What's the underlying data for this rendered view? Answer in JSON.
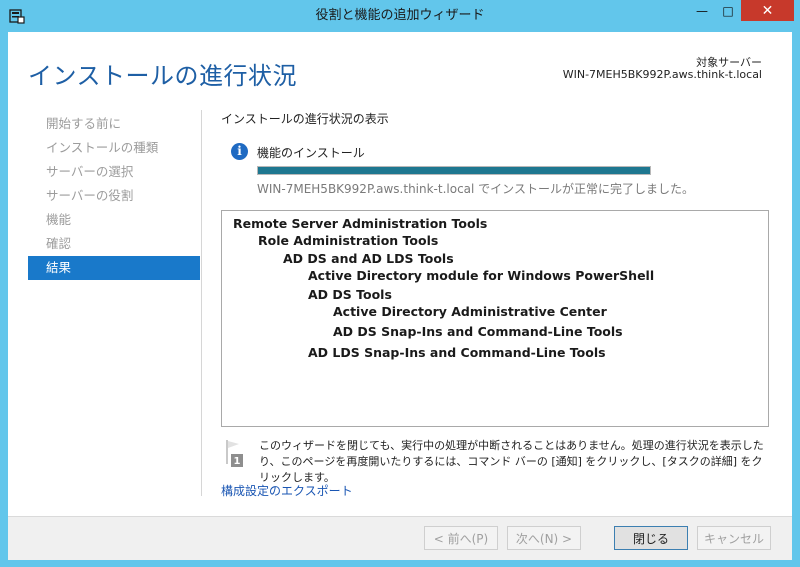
{
  "window": {
    "title": "役割と機能の追加ウィザード",
    "controls": {
      "minimize": "—",
      "maximize": "□",
      "close": "✕"
    }
  },
  "header": {
    "title": "インストールの進行状況",
    "destination_label": "対象サーバー",
    "destination_server": "WIN-7MEH5BK992P.aws.think-t.local"
  },
  "nav": {
    "items": [
      {
        "label": "開始する前に",
        "active": false
      },
      {
        "label": "インストールの種類",
        "active": false
      },
      {
        "label": "サーバーの選択",
        "active": false
      },
      {
        "label": "サーバーの役割",
        "active": false
      },
      {
        "label": "機能",
        "active": false
      },
      {
        "label": "確認",
        "active": false
      },
      {
        "label": "結果",
        "active": true
      }
    ]
  },
  "content": {
    "section_heading": "インストールの進行状況の表示",
    "info_icon_glyph": "i",
    "feature_label": "機能のインストール",
    "progress_fraction": 1.0,
    "status_text": "WIN-7MEH5BK992P.aws.think-t.local でインストールが正常に完了しました。",
    "tree": [
      {
        "text": "Remote Server Administration Tools",
        "level": 0
      },
      {
        "text": "Role Administration Tools",
        "level": 1
      },
      {
        "text": "AD DS and AD LDS Tools",
        "level": 2
      },
      {
        "text": "Active Directory module for Windows PowerShell",
        "level": 3
      },
      {
        "text": "AD DS Tools",
        "level": 3
      },
      {
        "text": "Active Directory Administrative Center",
        "level": 4
      },
      {
        "text": "AD DS Snap-Ins and Command-Line Tools",
        "level": 4
      },
      {
        "text": "AD LDS Snap-Ins and Command-Line Tools",
        "level": 3
      }
    ],
    "notice_icon_badge": "1",
    "notice_text": "このウィザードを閉じても、実行中の処理が中断されることはありません。処理の進行状況を表示したり、このページを再度開いたりするには、コマンド バーの [通知] をクリックし、[タスクの詳細] をクリックします。",
    "export_link": "構成設定のエクスポート"
  },
  "footer": {
    "prev_button": "< 前へ(P)",
    "next_button": "次へ(N) >",
    "close_button": "閉じる",
    "cancel_button": "キャンセル"
  },
  "colors": {
    "title_bar": "#62c6eb",
    "accent": "#1979ca",
    "header_title": "#1e5fa5",
    "progress_fill": "#1e7790",
    "close_button": "#c7392b"
  }
}
